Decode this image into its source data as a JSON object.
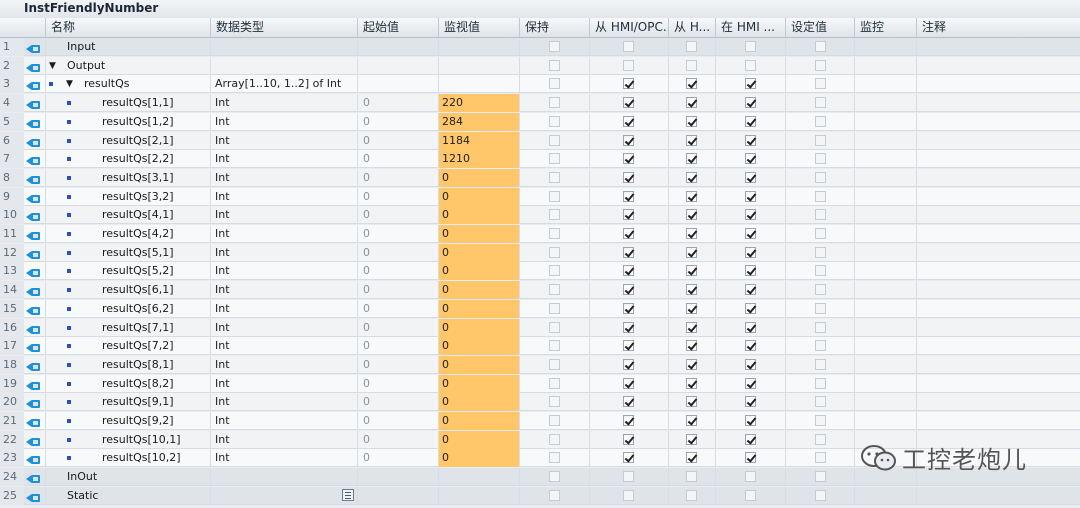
{
  "title": "InstFriendlyNumber",
  "columns": {
    "name": "名称",
    "dtype": "数据类型",
    "start": "起始值",
    "monitor": "监视值",
    "retain": "保持",
    "hmi_opc": "从 HMI/OPC...",
    "hmi_h": "从 H...",
    "hmi_in": "在 HMI ...",
    "setpoint": "设定值",
    "watch": "监控",
    "comment": "注释"
  },
  "rows": [
    {
      "num": "1",
      "name": "Input",
      "dtype": "",
      "start": "",
      "monitor": "",
      "level": 0,
      "expander": "none",
      "grp": true
    },
    {
      "num": "2",
      "name": "Output",
      "dtype": "",
      "start": "",
      "monitor": "",
      "level": 0,
      "expander": "open",
      "grp": false
    },
    {
      "num": "3",
      "name": "resultQs",
      "dtype": "Array[1..10, 1..2] of Int",
      "start": "",
      "monitor": "",
      "level": 1,
      "expander": "open",
      "grp": false
    },
    {
      "num": "4",
      "name": "resultQs[1,1]",
      "dtype": "Int",
      "start": "0",
      "monitor": "220",
      "level": 2
    },
    {
      "num": "5",
      "name": "resultQs[1,2]",
      "dtype": "Int",
      "start": "0",
      "monitor": "284",
      "level": 2
    },
    {
      "num": "6",
      "name": "resultQs[2,1]",
      "dtype": "Int",
      "start": "0",
      "monitor": "1184",
      "level": 2
    },
    {
      "num": "7",
      "name": "resultQs[2,2]",
      "dtype": "Int",
      "start": "0",
      "monitor": "1210",
      "level": 2
    },
    {
      "num": "8",
      "name": "resultQs[3,1]",
      "dtype": "Int",
      "start": "0",
      "monitor": "0",
      "level": 2
    },
    {
      "num": "9",
      "name": "resultQs[3,2]",
      "dtype": "Int",
      "start": "0",
      "monitor": "0",
      "level": 2
    },
    {
      "num": "10",
      "name": "resultQs[4,1]",
      "dtype": "Int",
      "start": "0",
      "monitor": "0",
      "level": 2
    },
    {
      "num": "11",
      "name": "resultQs[4,2]",
      "dtype": "Int",
      "start": "0",
      "monitor": "0",
      "level": 2
    },
    {
      "num": "12",
      "name": "resultQs[5,1]",
      "dtype": "Int",
      "start": "0",
      "monitor": "0",
      "level": 2
    },
    {
      "num": "13",
      "name": "resultQs[5,2]",
      "dtype": "Int",
      "start": "0",
      "monitor": "0",
      "level": 2
    },
    {
      "num": "14",
      "name": "resultQs[6,1]",
      "dtype": "Int",
      "start": "0",
      "monitor": "0",
      "level": 2
    },
    {
      "num": "15",
      "name": "resultQs[6,2]",
      "dtype": "Int",
      "start": "0",
      "monitor": "0",
      "level": 2
    },
    {
      "num": "16",
      "name": "resultQs[7,1]",
      "dtype": "Int",
      "start": "0",
      "monitor": "0",
      "level": 2
    },
    {
      "num": "17",
      "name": "resultQs[7,2]",
      "dtype": "Int",
      "start": "0",
      "monitor": "0",
      "level": 2
    },
    {
      "num": "18",
      "name": "resultQs[8,1]",
      "dtype": "Int",
      "start": "0",
      "monitor": "0",
      "level": 2
    },
    {
      "num": "19",
      "name": "resultQs[8,2]",
      "dtype": "Int",
      "start": "0",
      "monitor": "0",
      "level": 2
    },
    {
      "num": "20",
      "name": "resultQs[9,1]",
      "dtype": "Int",
      "start": "0",
      "monitor": "0",
      "level": 2
    },
    {
      "num": "21",
      "name": "resultQs[9,2]",
      "dtype": "Int",
      "start": "0",
      "monitor": "0",
      "level": 2
    },
    {
      "num": "22",
      "name": "resultQs[10,1]",
      "dtype": "Int",
      "start": "0",
      "monitor": "0",
      "level": 2
    },
    {
      "num": "23",
      "name": "resultQs[10,2]",
      "dtype": "Int",
      "start": "0",
      "monitor": "0",
      "level": 2
    },
    {
      "num": "24",
      "name": "InOut",
      "dtype": "",
      "start": "",
      "monitor": "",
      "level": 0,
      "expander": "none",
      "grp": true
    },
    {
      "num": "25",
      "name": "Static",
      "dtype": "",
      "start": "",
      "monitor": "",
      "level": 0,
      "expander": "none",
      "grp": true,
      "listicon": true
    }
  ],
  "watermark": "工控老炮儿",
  "colors": {
    "monitor_highlight": "#ffc76a",
    "pin_icon": "#1f8fd6"
  }
}
